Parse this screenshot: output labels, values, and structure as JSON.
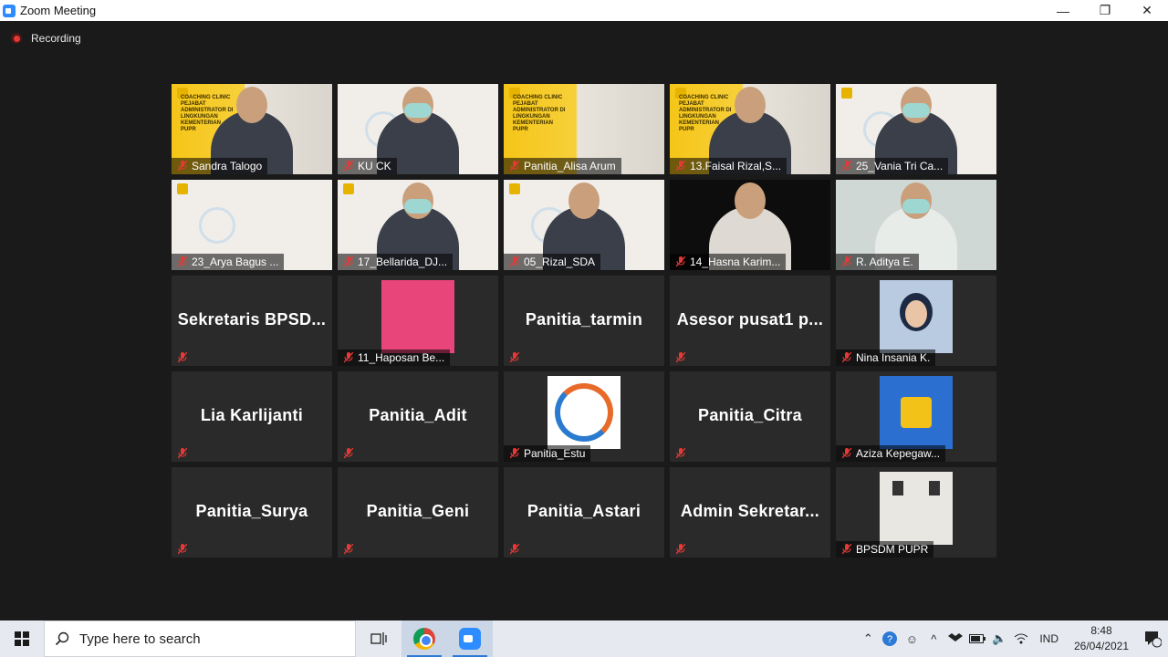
{
  "window": {
    "title": "Zoom Meeting",
    "minimize": "—",
    "restore": "❐",
    "close": "✕"
  },
  "meeting": {
    "recording_label": "Recording"
  },
  "tiles": [
    {
      "name": "Sandra Talogo"
    },
    {
      "name": "KU CK"
    },
    {
      "name": "Panitia_Alisa Arum"
    },
    {
      "name": "13.Faisal Rizal,S..."
    },
    {
      "name": "25_Vania Tri Ca..."
    },
    {
      "name": "23_Arya Bagus ..."
    },
    {
      "name": "17_Bellarida_DJ..."
    },
    {
      "name": "05_Rizal_SDA"
    },
    {
      "name": "14_Hasna Karim..."
    },
    {
      "name": "R. Aditya E."
    },
    {
      "big": "Sekretaris  BPSD..."
    },
    {
      "name": "11_Haposan Be..."
    },
    {
      "big": "Panitia_tarmin"
    },
    {
      "big": "Asesor  pusat1  p..."
    },
    {
      "name": "Nina Insania K."
    },
    {
      "big": "Lia Karlijanti"
    },
    {
      "big": "Panitia_Adit"
    },
    {
      "name": "Panitia_Estu"
    },
    {
      "big": "Panitia_Citra"
    },
    {
      "name": "Aziza Kepegaw..."
    },
    {
      "big": "Panitia_Surya"
    },
    {
      "big": "Panitia_Geni"
    },
    {
      "big": "Panitia_Astari"
    },
    {
      "big": "Admin  Sekretar..."
    },
    {
      "name": "BPSDM PUPR"
    }
  ],
  "slide_text": {
    "coaching": "COACHING CLINIC PEJABAT ADMINISTRATOR DI LINGKUNGAN KEMENTERIAN PUPR"
  },
  "taskbar": {
    "search_placeholder": "Type here to search",
    "language": "IND",
    "time": "8:48",
    "date": "26/04/2021",
    "notification_count": "1"
  }
}
